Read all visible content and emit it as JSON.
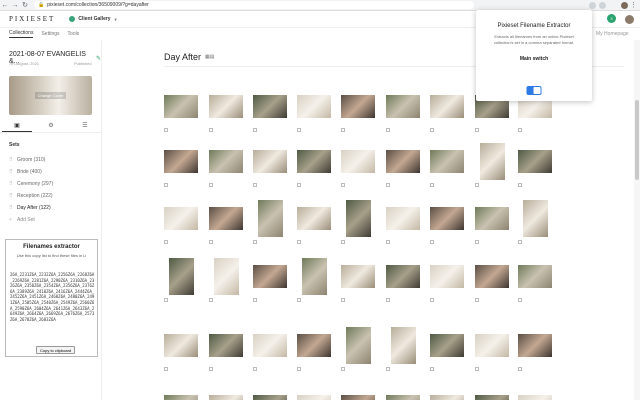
{
  "browser": {
    "url": "pixieset.com/collection/36509009/?g=dayafter"
  },
  "header": {
    "logo": "PIXIESET",
    "gallery_switch": "Client Gallery",
    "notification_count": "3"
  },
  "subnav": [
    "Collections",
    "Settings",
    "Tools"
  ],
  "homepage_link": "My Homepage",
  "sidebar": {
    "title": "2021-08-07 EVANGELIS &...",
    "date": "7th August, 2021",
    "status": "Published",
    "cover_label": "Change Cover",
    "sets_label": "Sets",
    "sets": [
      {
        "label": "Groom (310)"
      },
      {
        "label": "Bride (400)"
      },
      {
        "label": "Ceremony (297)"
      },
      {
        "label": "Reception (222)"
      },
      {
        "label": "Day After (122)"
      },
      {
        "label": "Add Set"
      }
    ]
  },
  "extractor": {
    "title": "Filenames extractor",
    "hint": "Use this copy list to find these files in Li",
    "output": "26A_2231Z6A_2232Z6A_2256Z6A_2268Z6A_2269Z6A_2281Z6A_2290Z6A_2310Z6A_2326Z6A_2350Z6A_2354Z6A_2356Z6A_2376Z6A_2389Z6A_2410Z6A_2416Z6A_2444Z6A_2452Z6A_2451Z6A_2468Z6A_2480Z6A_2491Z6A_2505Z6A_2540Z6A_2549Z6A_2560Z6A_2590Z6A_2604Z6A_2641Z6A_2643Z6A_2649Z6A_2664Z6A_2669Z6A_2676Z6A_2573Z6A_2678Z6A_2683Z6A",
    "copy_button": "Copy to clipboard"
  },
  "main": {
    "set_title": "Day After"
  },
  "popup": {
    "title": "Pixieset Filename Extractor",
    "description": "Extracts all filenames from an online Pixieset collection's set in a comma separated format.",
    "switch_label": "Main switch",
    "switch_on": true
  },
  "colors": {
    "accent": "#2ba36e",
    "switch": "#2f7be6"
  }
}
